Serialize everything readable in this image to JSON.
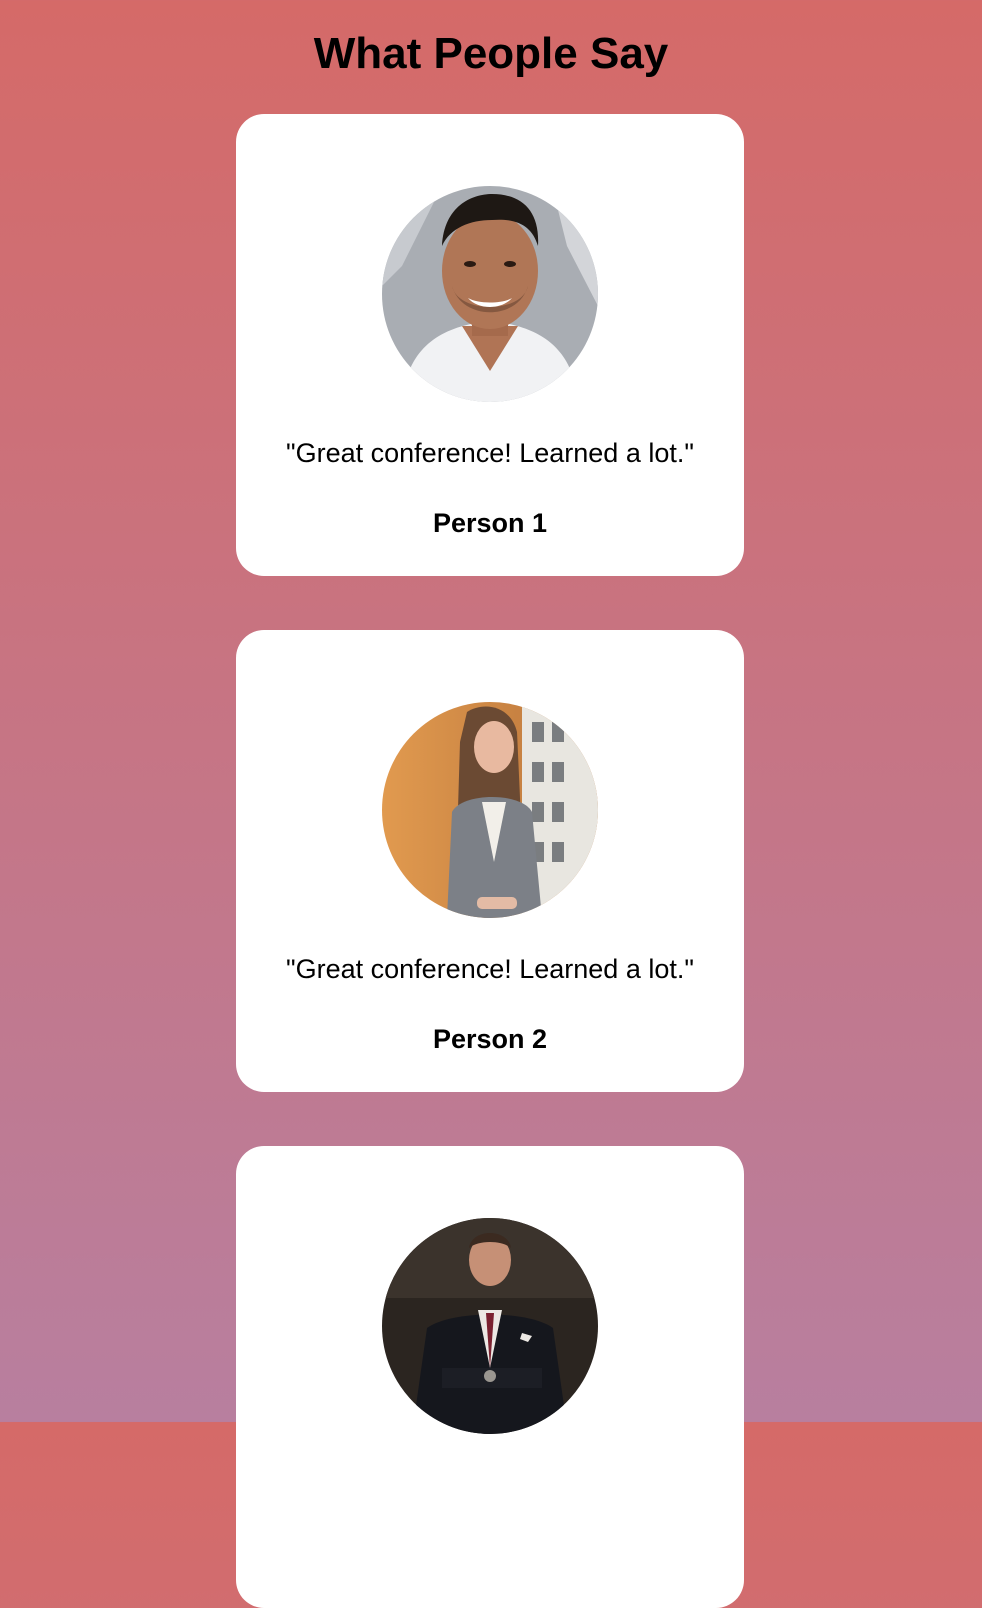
{
  "page": {
    "title": "What People Say",
    "background_top": "#d56a68",
    "background_bottom": "#b87f9f"
  },
  "testimonials": [
    {
      "quote": "\"Great conference! Learned a lot.\"",
      "name": "Person 1",
      "avatar": "man-white-tshirt-portrait"
    },
    {
      "quote": "\"Great conference! Learned a lot.\"",
      "name": "Person 2",
      "avatar": "woman-grey-blazer-portrait"
    },
    {
      "quote": "",
      "name": "",
      "avatar": "man-dark-suit-portrait"
    }
  ]
}
